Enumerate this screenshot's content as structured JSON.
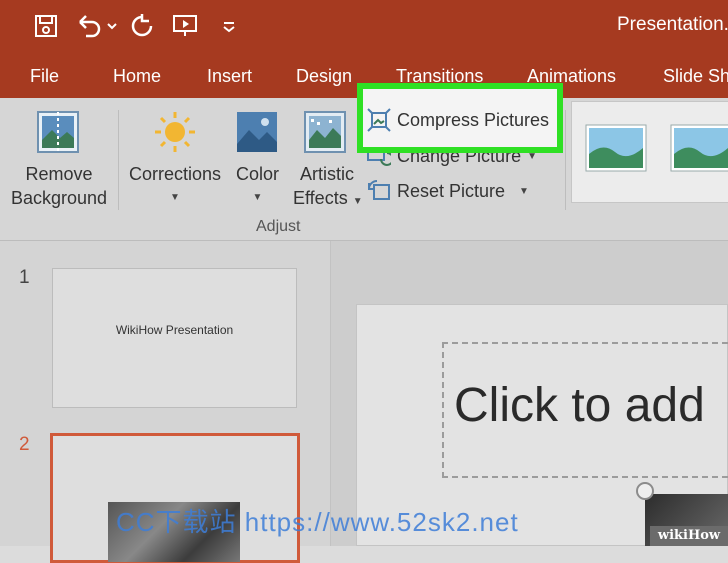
{
  "window": {
    "title": "Presentation.p"
  },
  "tabs": [
    {
      "label": "File"
    },
    {
      "label": "Home"
    },
    {
      "label": "Insert"
    },
    {
      "label": "Design"
    },
    {
      "label": "Transitions"
    },
    {
      "label": "Animations"
    },
    {
      "label": "Slide Sh"
    }
  ],
  "ribbon": {
    "remove_background": [
      "Remove",
      "Background"
    ],
    "corrections": "Corrections",
    "color": "Color",
    "artistic_effects": [
      "Artistic",
      "Effects"
    ],
    "compress_pictures": "Compress Pictures",
    "change_picture": "Change Picture",
    "reset_picture": "Reset Picture",
    "group_adjust": "Adjust"
  },
  "slides": [
    {
      "number": "1",
      "title": "WikiHow Presentation"
    },
    {
      "number": "2"
    }
  ],
  "slide": {
    "placeholder": "Click to add"
  },
  "watermark": "CC下载站 https://www.52sk2.net",
  "badge": "wikiHow",
  "colors": {
    "ribbon_accent": "#a63a20",
    "highlight": "#2fe024",
    "selected_slide": "#d05a3a"
  }
}
